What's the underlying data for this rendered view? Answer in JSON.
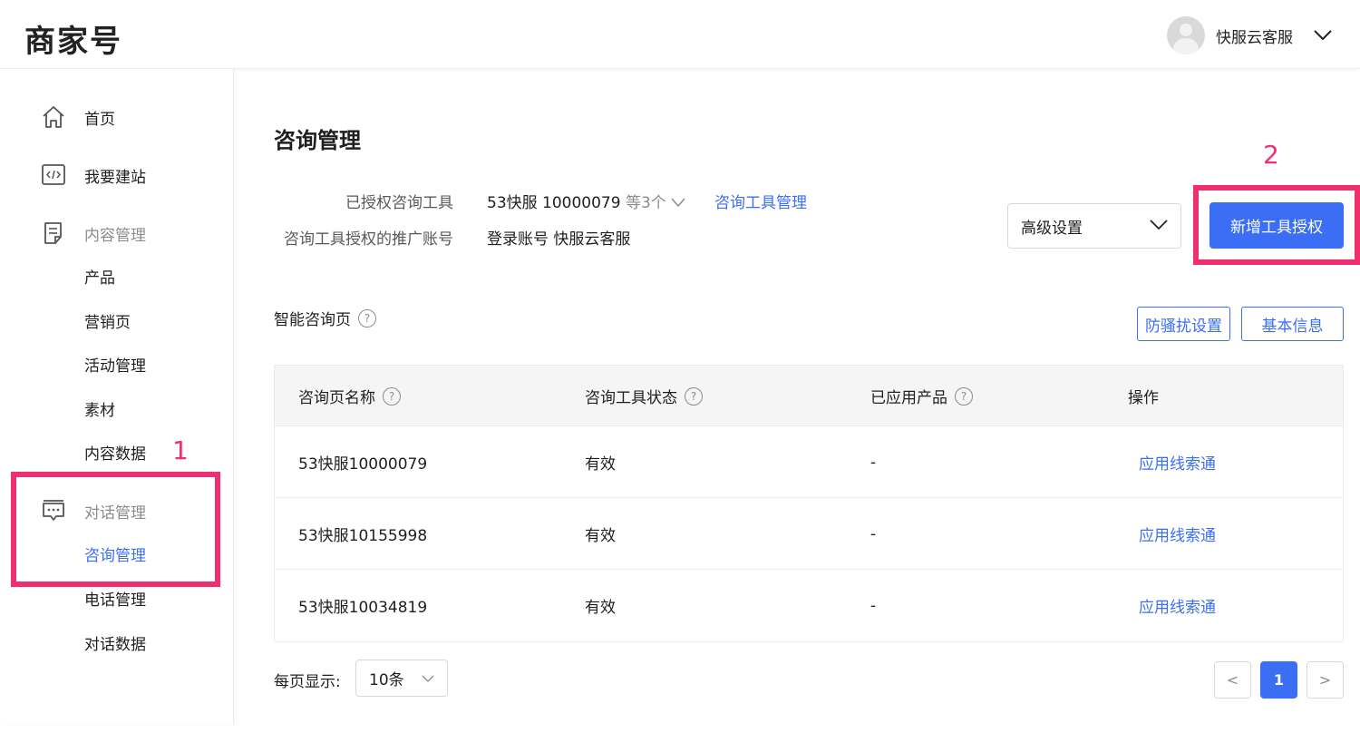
{
  "header": {
    "logo": "商家号",
    "username": "快服云客服"
  },
  "sidebar": {
    "home": "首页",
    "build_site": "我要建站",
    "content_group": "内容管理",
    "content_items": [
      "产品",
      "营销页",
      "活动管理",
      "素材",
      "内容数据"
    ],
    "dialog_group": "对话管理",
    "dialog_items": [
      "咨询管理",
      "电话管理",
      "对话数据"
    ]
  },
  "annotations": {
    "step1": "1",
    "step2": "2",
    "color": "#f0306d"
  },
  "main": {
    "title": "咨询管理",
    "authorized_tools_label": "已授权咨询工具",
    "authorized_tools_value": "53快服 10000079",
    "authorized_tools_more": "等3个",
    "tools_manage_link": "咨询工具管理",
    "promo_account_label": "咨询工具授权的推广账号",
    "promo_account_value": "登录账号 快服云客服",
    "advanced_settings": "高级设置",
    "add_auth_button": "新增工具授权",
    "section_title": "智能咨询页",
    "anti_harass_button": "防骚扰设置",
    "basic_info_button": "基本信息"
  },
  "table": {
    "headers": [
      "咨询页名称",
      "咨询工具状态",
      "已应用产品",
      "操作"
    ],
    "rows": [
      {
        "name": "53快服10000079",
        "status": "有效",
        "product": "-",
        "action": "应用线索通"
      },
      {
        "name": "53快服10155998",
        "status": "有效",
        "product": "-",
        "action": "应用线索通"
      },
      {
        "name": "53快服10034819",
        "status": "有效",
        "product": "-",
        "action": "应用线索通"
      }
    ]
  },
  "pagination": {
    "pagesize_label": "每页显示:",
    "pagesize_value": "10条",
    "current_page": "1",
    "prev": "<",
    "next": ">"
  },
  "colors": {
    "accent": "#3b6ef5",
    "annotation": "#f0306d"
  }
}
